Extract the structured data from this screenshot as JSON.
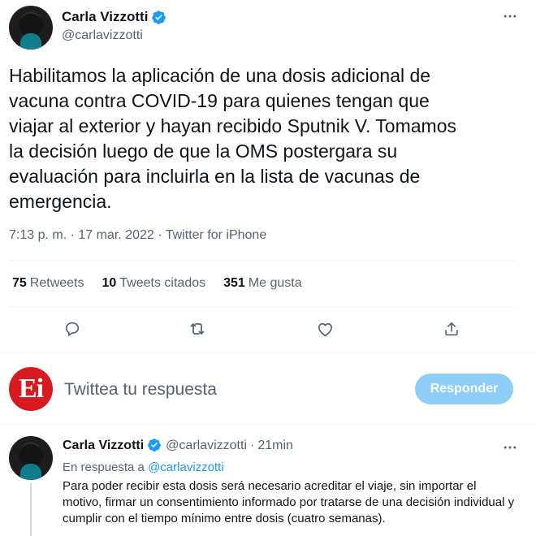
{
  "main_tweet": {
    "display_name": "Carla Vizzotti",
    "handle": "@carlavizzotti",
    "text": "Habilitamos la aplicación de una dosis adicional de\nvacuna contra COVID-19 para quienes tengan que\nviajar al exterior y hayan recibido Sputnik V. Tomamos\nla decisión luego de que la OMS postergara su\nevaluación para incluirla en la lista de vacunas de\nemergencia.",
    "time": "7:13 p. m.",
    "separator": " · ",
    "date": "17 mar. 2022",
    "source": "Twitter for iPhone",
    "stats": {
      "retweets_count": "75",
      "retweets_label": "Retweets",
      "quotes_count": "10",
      "quotes_label": "Tweets citados",
      "likes_count": "351",
      "likes_label": "Me gusta"
    }
  },
  "icons": {
    "verified": "verified-badge-icon",
    "more": "more-horizontal-icon",
    "reply": "reply-bubble-icon",
    "retweet": "retweet-icon",
    "like": "heart-icon",
    "share": "share-icon"
  },
  "composer": {
    "avatar_text": "Ei",
    "placeholder": "Twittea tu respuesta",
    "button_label": "Responder"
  },
  "reply_tweet": {
    "display_name": "Carla Vizzotti",
    "handle": "@carlavizzotti",
    "separator": "·",
    "time_ago": "21min",
    "in_reply_prefix": "En respuesta a",
    "in_reply_handle": "@carlavizzotti",
    "text": "Para poder recibir esta dosis será necesario acreditar el viaje, sin importar el motivo, firmar un consentimiento informado por tratarse de una decisión individual y cumplir con el tiempo mínimo entre dosis (cuatro semanas)."
  },
  "colors": {
    "accent": "#1d9bf0",
    "button_disabled": "#8ecdf8",
    "secondary_text": "#536471",
    "divider": "#eff3f4",
    "composer_avatar": "#d71920"
  }
}
